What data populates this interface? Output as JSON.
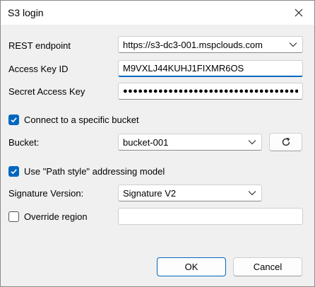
{
  "window": {
    "title": "S3 login"
  },
  "fields": {
    "rest_endpoint": {
      "label": "REST endpoint",
      "value": "https://s3-dc3-001.mspclouds.com"
    },
    "access_key": {
      "label": "Access Key ID",
      "value": "M9VXLJ44KUHJ1FIXMR6OS"
    },
    "secret_key": {
      "label": "Secret Access Key",
      "value": "●●●●●●●●●●●●●●●●●●●●●●●●●●●●●●●●●●●●●●●●"
    }
  },
  "connect_bucket": {
    "label": "Connect to a specific bucket",
    "checked": true
  },
  "bucket": {
    "label": "Bucket:",
    "value": "bucket-001"
  },
  "path_style": {
    "label": "Use \"Path style\" addressing model",
    "checked": true
  },
  "signature": {
    "label": "Signature Version:",
    "value": "Signature V2"
  },
  "override_region": {
    "label": "Override region",
    "checked": false,
    "value": ""
  },
  "buttons": {
    "ok": "OK",
    "cancel": "Cancel"
  },
  "icons": {
    "close": "close-icon",
    "dropdown": "chevron-down-icon",
    "refresh": "refresh-icon",
    "check": "checkmark-icon"
  },
  "colors": {
    "accent": "#0067c0"
  }
}
